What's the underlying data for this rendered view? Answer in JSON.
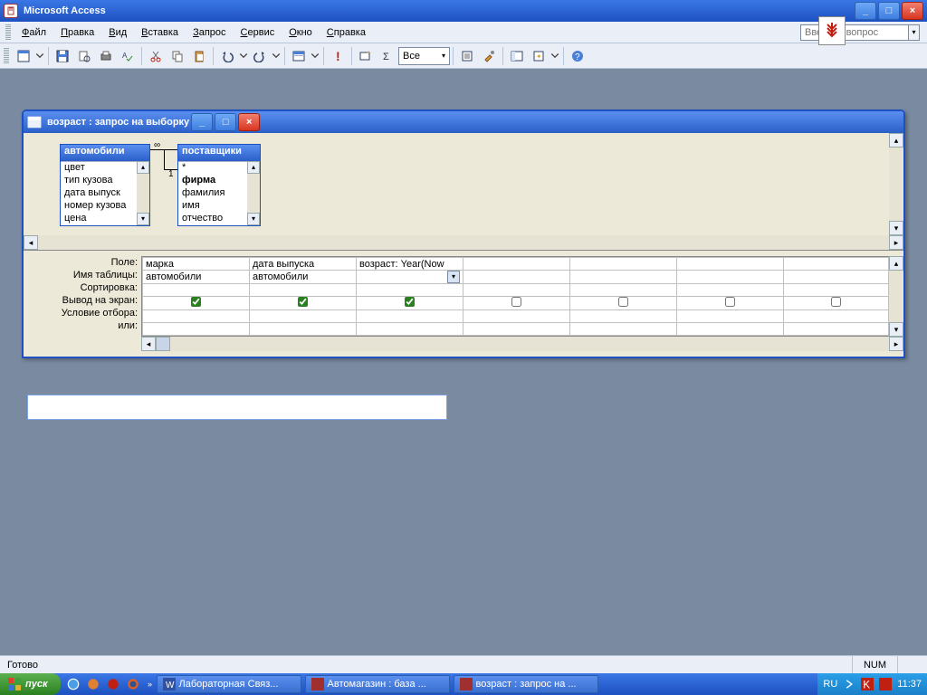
{
  "app": {
    "title": "Microsoft Access"
  },
  "menu": {
    "items": [
      "Файл",
      "Правка",
      "Вид",
      "Вставка",
      "Запрос",
      "Сервис",
      "Окно",
      "Справка"
    ]
  },
  "search": {
    "placeholder": "Введите вопрос"
  },
  "toolbar": {
    "combo": "Все"
  },
  "inner": {
    "title": "возраст : запрос на выборку"
  },
  "tables": {
    "t1": {
      "name": "автомобили",
      "fields": [
        "цвет",
        "тип кузова",
        "дата выпуск",
        "номер кузова",
        "цена"
      ]
    },
    "t2": {
      "name": "поставщики",
      "fields": [
        "*",
        "фирма",
        "фамилия",
        "имя",
        "отчество"
      ],
      "bold_index": 1
    },
    "rel": {
      "left_symbol": "∞",
      "right_symbol": "1"
    }
  },
  "gridLabels": [
    "Поле:",
    "Имя таблицы:",
    "Сортировка:",
    "Вывод на экран:",
    "Условие отбора:",
    "или:"
  ],
  "grid": {
    "cols": [
      {
        "field": "марка",
        "table": "автомобили",
        "show": true
      },
      {
        "field": "дата выпуска",
        "table": "автомобили",
        "show": true
      },
      {
        "field": "возраст: Year(Now",
        "table": "",
        "show": true,
        "combo": true
      },
      {
        "field": "",
        "table": "",
        "show": false
      },
      {
        "field": "",
        "table": "",
        "show": false
      },
      {
        "field": "",
        "table": "",
        "show": false
      },
      {
        "field": "",
        "table": "",
        "show": false
      }
    ]
  },
  "status": {
    "text": "Готово",
    "num": "NUM"
  },
  "taskbar": {
    "start": "пуск",
    "tasks": [
      "Лабораторная Связ...",
      "Автомагазин : база ...",
      "возраст : запрос на ..."
    ],
    "lang": "RU",
    "time": "11:37"
  }
}
